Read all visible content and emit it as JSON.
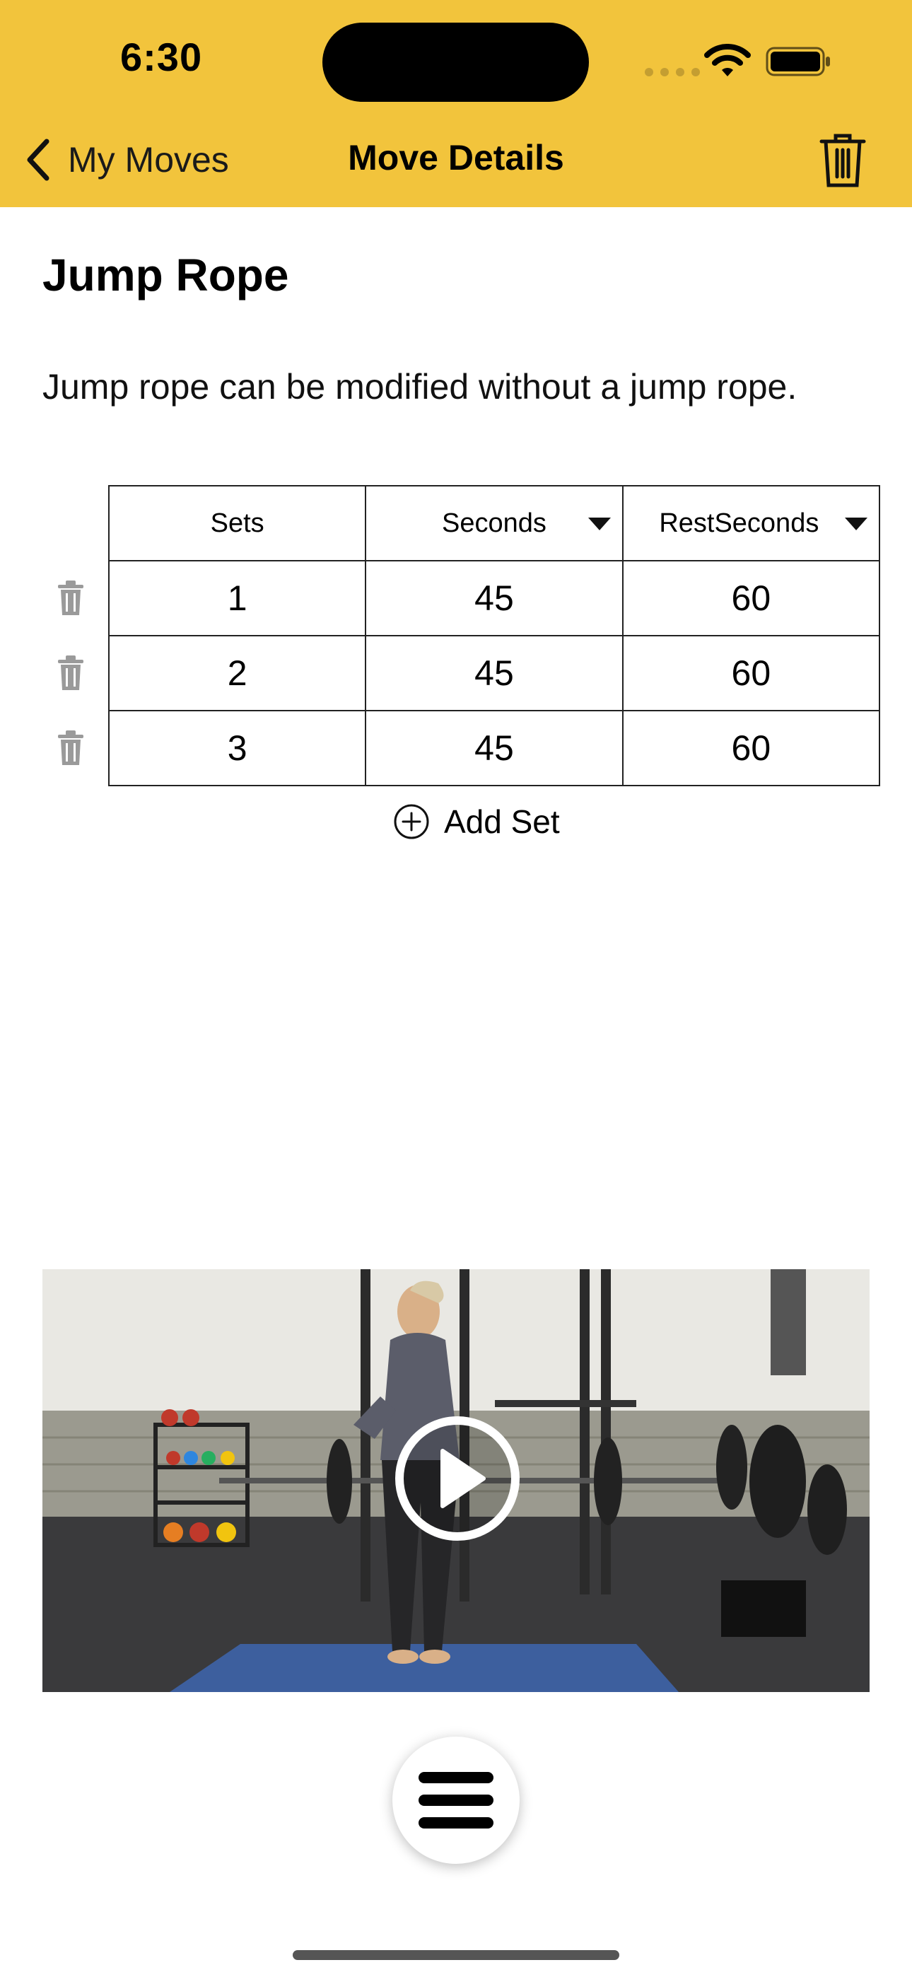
{
  "status_bar": {
    "time": "6:30"
  },
  "nav": {
    "back_label": "My Moves",
    "title": "Move Details"
  },
  "move": {
    "name": "Jump Rope",
    "description": "Jump rope can be modified without a jump rope."
  },
  "sets_table": {
    "columns": [
      "Sets",
      "Seconds",
      "RestSeconds"
    ],
    "rows": [
      [
        "1",
        "45",
        "60"
      ],
      [
        "2",
        "45",
        "60"
      ],
      [
        "3",
        "45",
        "60"
      ]
    ]
  },
  "add_set_label": "Add Set",
  "colors": {
    "header_bg": "#f2c43c",
    "row_delete_icon": "#9a9a9a"
  },
  "icons": {
    "back": "chevron-left-icon",
    "delete_move": "trash-icon",
    "row_delete": "trash-icon",
    "add_set": "plus-circle-icon",
    "video_play": "play-icon",
    "menu": "menu-icon"
  }
}
